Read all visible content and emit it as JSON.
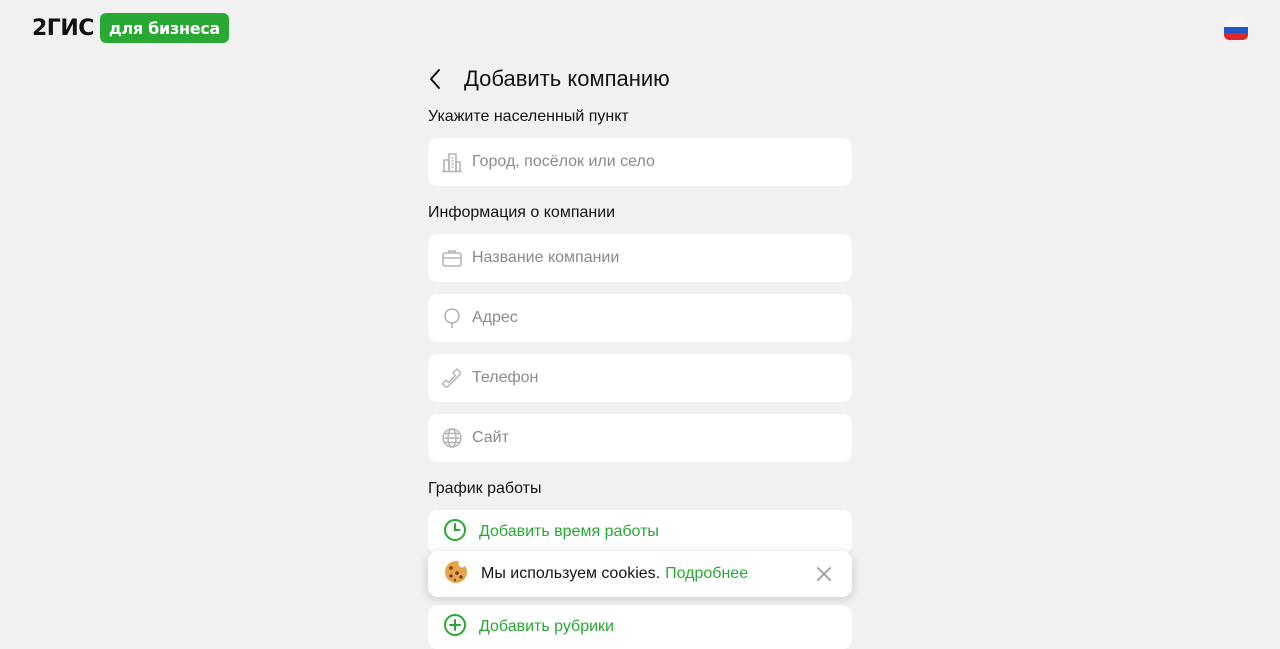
{
  "header": {
    "logo_text": "2ГИС",
    "logo_badge": "для бизнеса",
    "language_flag": "ru-flag-icon"
  },
  "form": {
    "title": "Добавить компанию",
    "locality_label": "Укажите населенный пункт",
    "locality_placeholder": "Город, посёлок или село",
    "company_info_label": "Информация о компании",
    "company_name_placeholder": "Название компании",
    "address_placeholder": "Адрес",
    "phone_placeholder": "Телефон",
    "site_placeholder": "Сайт",
    "schedule_label": "График работы",
    "add_hours_label": "Добавить время работы",
    "add_rubrics_label": "Добавить рубрики"
  },
  "cookie_banner": {
    "text": "Мы используем cookies.",
    "link": "Подробнее"
  },
  "colors": {
    "accent": "#29a834",
    "background": "#f1f1f1",
    "field": "#ffffff",
    "icon": "#b4b4b4"
  }
}
